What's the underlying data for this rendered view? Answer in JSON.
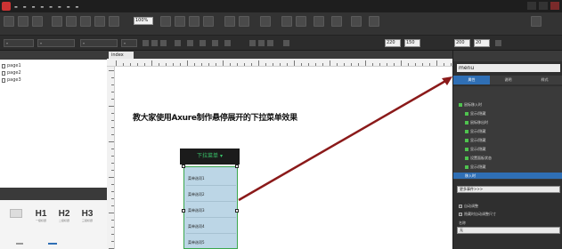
{
  "canvas": {
    "tab_label": "index",
    "title_text": "教大家使用Axure制作悬停展开的下拉菜单效果",
    "dropdown_button_label": "下拉菜单 ▾",
    "dropdown_items": [
      "菜单选项1",
      "菜单选项2",
      "菜单选项3",
      "菜单选项4",
      "菜单选项5"
    ]
  },
  "toolbar": {
    "zoom": "100%"
  },
  "stylebar": {
    "x": "220",
    "y": "150",
    "w": "200",
    "h": "20"
  },
  "sitemap": {
    "pages": [
      "page1",
      "page2",
      "page3"
    ]
  },
  "widgets": [
    {
      "big": "H1",
      "label": "一级标题"
    },
    {
      "big": "H2",
      "label": "二级标题"
    },
    {
      "big": "H3",
      "label": "三级标题"
    }
  ],
  "inspector": {
    "name_value": "menu",
    "tabs": [
      "属性",
      "说明",
      "样式"
    ],
    "interactions": [
      "鼠标移入时",
      "显示/隐藏",
      "鼠标移出时",
      "显示/隐藏",
      "显示/隐藏",
      "显示/隐藏",
      "设置面板状态",
      "显示/隐藏",
      "显示/隐藏",
      "移入时"
    ],
    "more_events": "更多事件>>>",
    "checkbox_1": "自动调整",
    "checkbox_2": "隐藏时自动调整尺寸",
    "field_label": "名称",
    "field_value": "无"
  },
  "colors": {
    "dropdown_button_bg": "#1b1b1b",
    "dropdown_button_text": "#39c46a",
    "dropdown_panel_bg": "#bcd6e6",
    "selection_blue": "#2f6fb5",
    "arrow": "#8b1a1a"
  }
}
